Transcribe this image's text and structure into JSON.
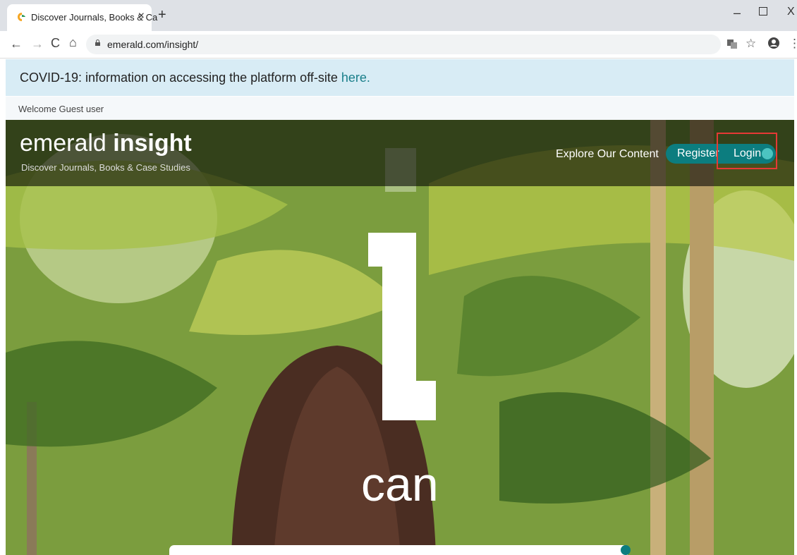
{
  "browser": {
    "tab_title": "Discover Journals, Books & Ca",
    "close_tab": "×",
    "new_tab": "+",
    "url": "emerald.com/insight/"
  },
  "banner": {
    "text": "COVID-19: information on accessing the platform off-site ",
    "link": "here."
  },
  "welcome": "Welcome Guest user",
  "site": {
    "logo_light": "emerald ",
    "logo_bold": "insight",
    "tagline": "Discover Journals, Books & Case Studies",
    "explore": "Explore Our Content",
    "register": "Register",
    "login": "Login"
  },
  "hero": {
    "caption": "can"
  },
  "colors": {
    "accent": "#0c7d7f",
    "banner_bg": "#d8ecf5",
    "highlight": "#e53935"
  }
}
